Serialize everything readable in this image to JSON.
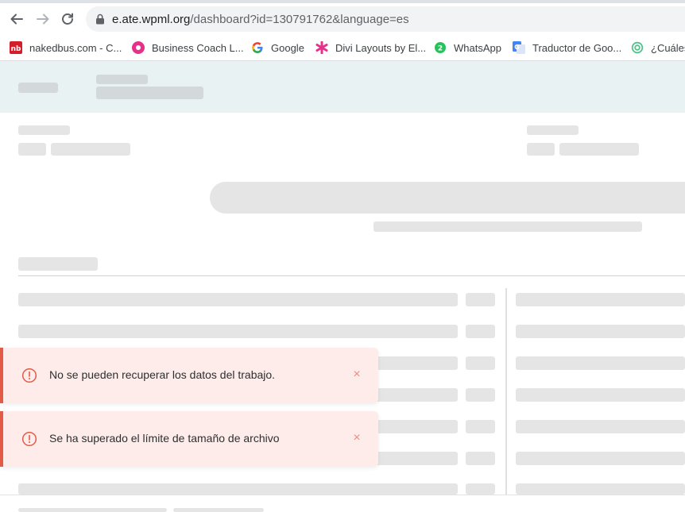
{
  "browser": {
    "url_host": "e.ate.wpml.org",
    "url_path": "/dashboard?id=130791762&language=es",
    "bookmarks": [
      {
        "label": "nakedbus.com - C...",
        "icon": "nakedbus-icon"
      },
      {
        "label": "Business Coach L...",
        "icon": "business-coach-icon"
      },
      {
        "label": "Google",
        "icon": "google-icon"
      },
      {
        "label": "Divi Layouts by El...",
        "icon": "divi-icon"
      },
      {
        "label": "WhatsApp",
        "icon": "whatsapp-icon"
      },
      {
        "label": "Traductor de Goo...",
        "icon": "google-translate-icon"
      },
      {
        "label": "¿Cuáles",
        "icon": "link-icon"
      }
    ]
  },
  "toasts": [
    {
      "message": "No se pueden recuperar los datos del trabajo.",
      "close": "×",
      "icon": "info-circle-icon"
    },
    {
      "message": "Se ha superado el límite de tamaño de archivo",
      "close": "×",
      "icon": "info-circle-icon"
    }
  ],
  "colors": {
    "header_bg": "#e8f2f3",
    "skeleton": "#e5e5e5",
    "toast_bg": "#fdecea",
    "toast_accent": "#e35a46"
  }
}
